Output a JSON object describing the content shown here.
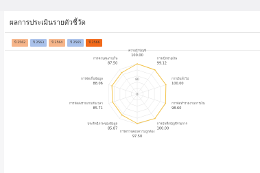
{
  "page": {
    "title": "ผลการประเมินรายตัวชี้วัด"
  },
  "tabs": [
    {
      "label": "ปี 2562",
      "color": "#f6b58a"
    },
    {
      "label": "ปี 2563",
      "color": "#a9c1ea"
    },
    {
      "label": "ปี 2564",
      "color": "#f6b58a"
    },
    {
      "label": "ปี 2565",
      "color": "#a9c1ea"
    },
    {
      "label": "ปี 2566",
      "color": "#f26a1b"
    }
  ],
  "chart_data": {
    "type": "radar",
    "ring_labels": [
      "80",
      "0"
    ],
    "max": 100,
    "series": [
      {
        "color": "#f3c44c",
        "values": [
          100,
          99.12,
          100,
          98.6,
          100,
          97.5,
          85.87,
          85.71,
          88.06,
          87.5
        ]
      }
    ],
    "axes": [
      {
        "label": "ความรู้ฯบัญชี",
        "value_text": "100.00"
      },
      {
        "label": "การเบิกจ่ายเงิน",
        "value_text": "99.12"
      },
      {
        "label": "การเงินทั่วไป",
        "value_text": "100.00"
      },
      {
        "label": "การจัดทำรายงานการเงิน",
        "value_text": "98.60"
      },
      {
        "label": "การบันทึกบัญชีรายการ",
        "value_text": "100.00"
      },
      {
        "label": "การตรวจสอบความถูกต้อง",
        "value_text": "97.50"
      },
      {
        "label": "ประสิทธิภาพของข้อมูล",
        "value_text": "85.87"
      },
      {
        "label": "การจัดส่งรายงานทันเวลา",
        "value_text": "85.71"
      },
      {
        "label": "การจัดเก็บข้อมูล",
        "value_text": "88.06"
      },
      {
        "label": "การควบคุมภายใน",
        "value_text": "87.50"
      }
    ]
  }
}
